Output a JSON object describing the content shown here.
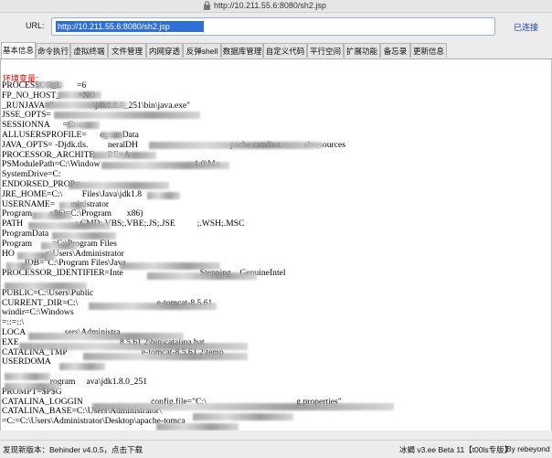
{
  "window": {
    "title": "http://10.211.55.6:8080/sh2.jsp"
  },
  "url_bar": {
    "label": "URL:",
    "value": "http://10.211.55.6:8080/sh2.jsp",
    "status": "已连接"
  },
  "tabs": [
    {
      "label": "基本信息",
      "active": true
    },
    {
      "label": "命令执行"
    },
    {
      "label": "虚拟终端"
    },
    {
      "label": "文件管理"
    },
    {
      "label": "内网穿透"
    },
    {
      "label": "反弹shell"
    },
    {
      "label": "数据库管理"
    },
    {
      "label": "自定义代码"
    },
    {
      "label": "平行空间"
    },
    {
      "label": "扩展功能"
    },
    {
      "label": "备忘录"
    },
    {
      "label": "更新信息"
    }
  ],
  "content": {
    "heading": "环境变量:",
    "lines": [
      "PROCESSOR_L       =6",
      "FP_NO_HOST_        =NO",
      "_RUNJAVA=\"                  \\jdk1.8.0_251\\bin\\java.exe\"",
      "JSSE_OPTS=",
      "SESSIONNA      =Con",
      "ALLUSERSPROFILE=      ogramData",
      "JAVA_OPTS= -Djdk.tls.         neralDH                                          pache.catalina.          ebresources",
      "PROCESSOR_ARCHITE      RE=A",
      "PSModulePath=C:\\Window                                           1.0\\Mo",
      "SystemDrive=C:",
      "ENDORSED_PROP=",
      "JRE_HOME=C:\\         Files\\Java\\jdk1.8",
      "USERNAME=       ministrator",
      "Program        x86)=C:\\Program       x86)",
      "PATH                        ;.CMD;.VBS;.VBE;.JS;.JSE          ;.WSH;.MSC",
      "ProgramData",
      "Program         =C:\\Program Files",
      "HO              =\\Users\\Administrator",
      "          JDB=\"C:\\Program Files\\Java",
      "PROCESSOR_IDENTIFIER=Inte                                   Stepping    GenuineIntel",
      "",
      "PUBLIC=C:\\Users\\Public",
      "CURRENT_DIR=C:\\                                    e-tomcat-8.5.61",
      "windir=C:\\Windows",
      "=::=::\\",
      "LOCA                  sers\\Administra",
      "EXE                                              8.5.61 2\\bin\\catalina.bat",
      "CATALINA_TMP                                  e-tomcat-8.5.61 2\\temp",
      "USERDOMA",
      "",
      "                      rogram     ava\\jdk1.8.0_251",
      "PROMPT=$P$G",
      "CATALINA_LOGGIN                               config.file=\"C:\\                                         g.properties\"",
      "CATALINA_BASE=C:\\Users\\Administrator\\",
      "=C:=C:\\Users\\Administrator\\Desktop\\apache-tomca"
    ]
  },
  "status_bar": {
    "left": "发现新版本：Behinder v4.0.5，点击下载",
    "center": "冰蝎 v3.ee Beta 11【t00ls专版】",
    "right": "By rebeyond"
  },
  "colors": {
    "heading": "#e00000",
    "status_link": "#1a3fb5",
    "selection": "#2f6fd8"
  }
}
